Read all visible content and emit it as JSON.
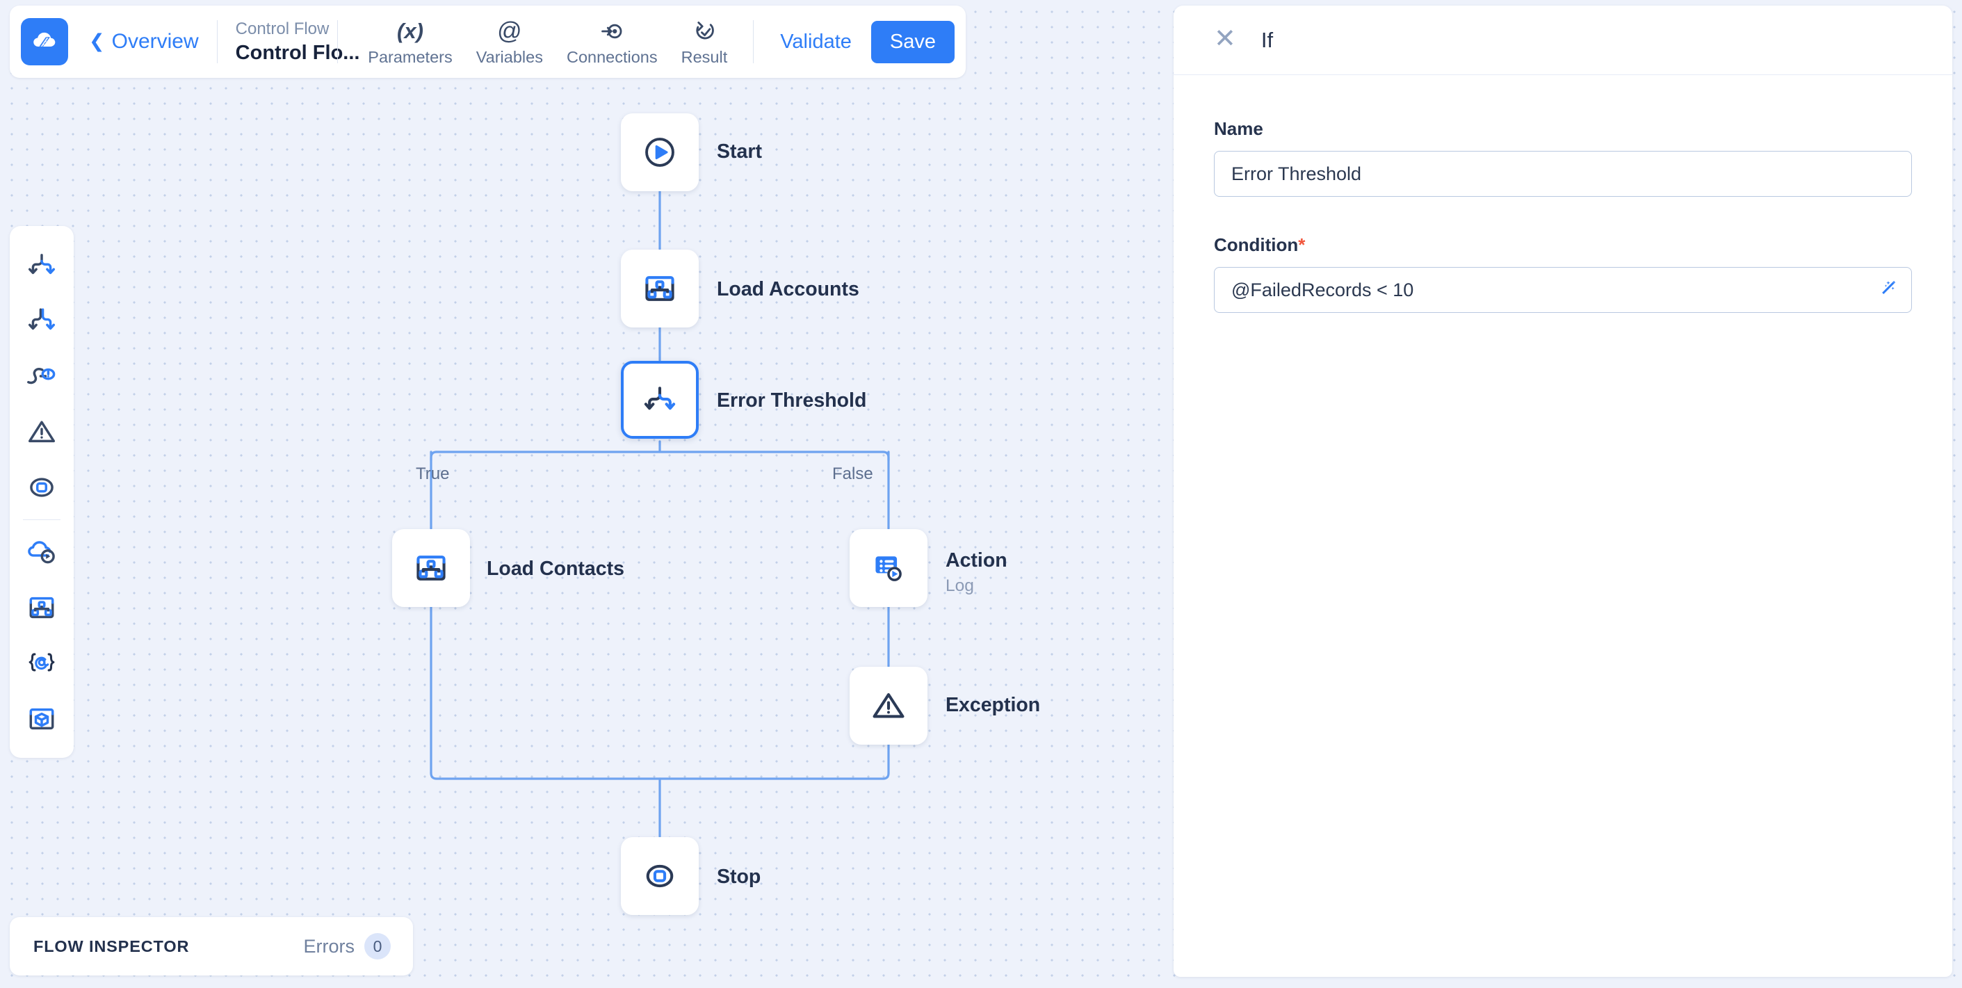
{
  "header": {
    "logo_icon": "cloud-logo-icon",
    "back_label": "Overview",
    "breadcrumb_parent": "Control Flow",
    "breadcrumb_current": "Control Flo...",
    "tools": [
      {
        "icon": "parameters-fx-icon",
        "glyph": "(x)",
        "label": "Parameters"
      },
      {
        "icon": "variables-at-icon",
        "glyph": "@",
        "label": "Variables"
      },
      {
        "icon": "connections-icon",
        "glyph": "",
        "label": "Connections"
      },
      {
        "icon": "result-icon",
        "glyph": "",
        "label": "Result"
      }
    ],
    "validate_label": "Validate",
    "save_label": "Save"
  },
  "palette": {
    "items": [
      {
        "icon": "if-branch-icon",
        "name": "palette-item-if"
      },
      {
        "icon": "switch-branch-icon",
        "name": "palette-item-switch"
      },
      {
        "icon": "try-catch-icon",
        "name": "palette-item-try-catch"
      },
      {
        "icon": "exception-warning-icon",
        "name": "palette-item-exception"
      },
      {
        "icon": "stop-icon",
        "name": "palette-item-stop"
      },
      {
        "icon": "cloud-action-icon",
        "name": "palette-item-cloud-action"
      },
      {
        "icon": "dataflow-icon",
        "name": "palette-item-dataflow"
      },
      {
        "icon": "expression-braces-icon",
        "name": "palette-item-expression"
      },
      {
        "icon": "package-cube-icon",
        "name": "palette-item-package"
      }
    ]
  },
  "flow": {
    "nodes": [
      {
        "id": "start",
        "icon": "start-play-icon",
        "label": "Start",
        "sub": "",
        "selected": false
      },
      {
        "id": "load-accounts",
        "icon": "dataflow-icon",
        "label": "Load Accounts",
        "sub": "",
        "selected": false
      },
      {
        "id": "error-threshold",
        "icon": "if-branch-icon",
        "label": "Error Threshold",
        "sub": "",
        "selected": true
      },
      {
        "id": "load-contacts",
        "icon": "dataflow-icon",
        "label": "Load Contacts",
        "sub": "",
        "selected": false
      },
      {
        "id": "action",
        "icon": "action-log-icon",
        "label": "Action",
        "sub": "Log",
        "selected": false
      },
      {
        "id": "exception",
        "icon": "exception-warning-icon",
        "label": "Exception",
        "sub": "",
        "selected": false
      },
      {
        "id": "stop",
        "icon": "stop-icon",
        "label": "Stop",
        "sub": "",
        "selected": false
      }
    ],
    "branch_true": "True",
    "branch_false": "False"
  },
  "inspector": {
    "title": "FLOW INSPECTOR",
    "errors_label": "Errors",
    "errors_count": "0"
  },
  "panel": {
    "title": "If",
    "close_icon": "close-icon",
    "name_label": "Name",
    "name_value": "Error Threshold",
    "condition_label": "Condition",
    "condition_required": "*",
    "condition_value": "@FailedRecords < 10",
    "condition_icon": "magic-wand-icon"
  },
  "colors": {
    "accent": "#2e7df7",
    "canvas_bg": "#eef2fb",
    "dot": "#c2d0e8",
    "ink": "#23314d",
    "muted": "#7b8daa",
    "required": "#f1563c"
  }
}
